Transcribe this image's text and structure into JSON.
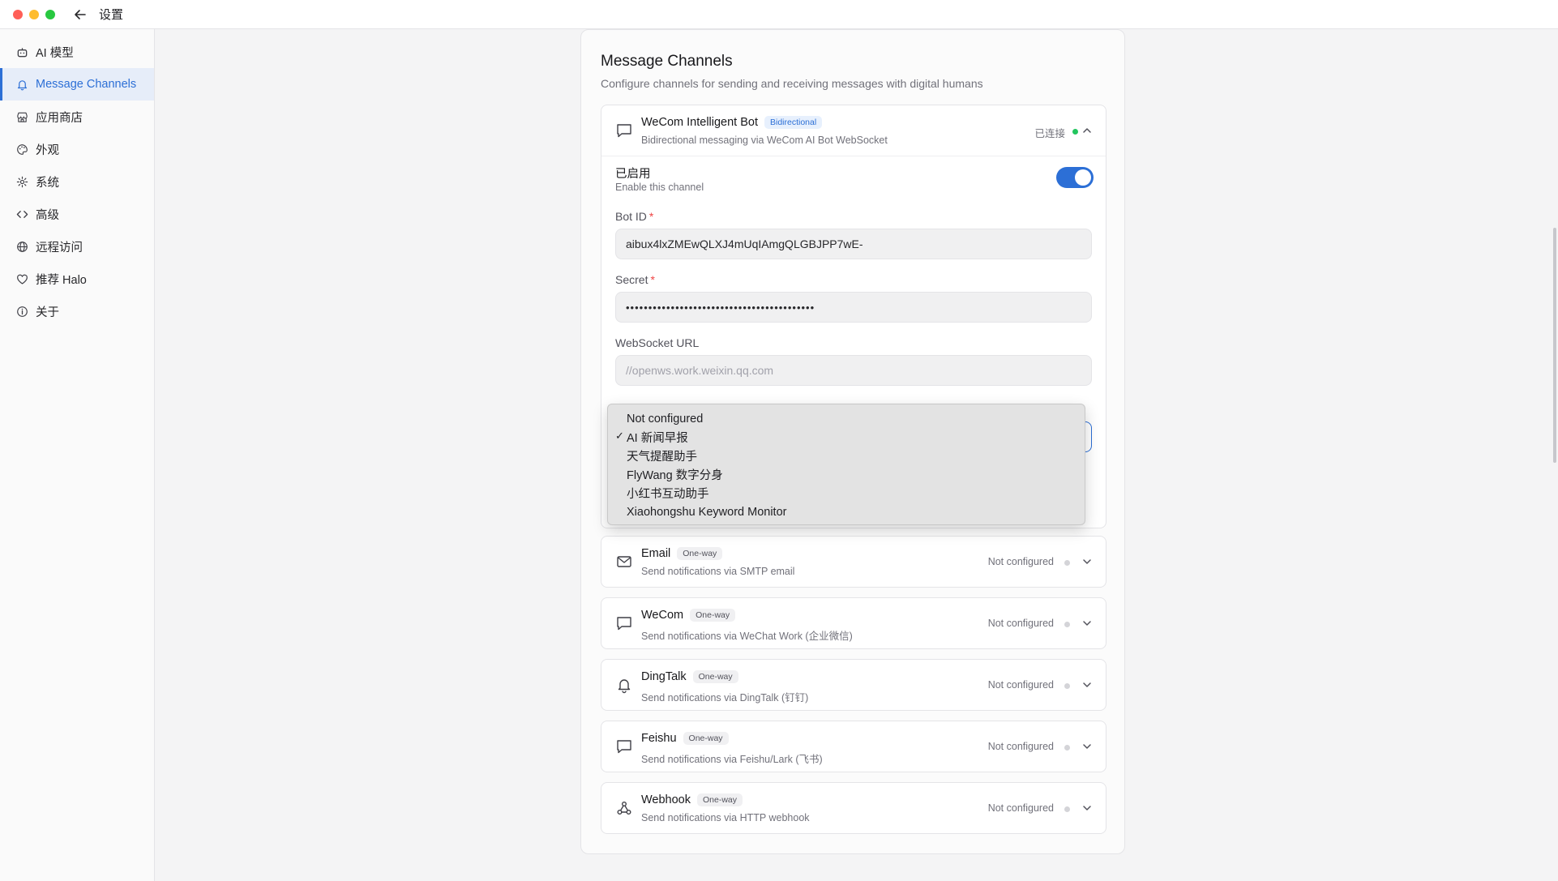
{
  "window": {
    "title": "设置"
  },
  "sidebar": {
    "items": [
      {
        "label": "AI 模型",
        "icon": "robot-icon",
        "active": false
      },
      {
        "label": "Message Channels",
        "icon": "bell-icon",
        "active": true
      },
      {
        "label": "应用商店",
        "icon": "store-icon",
        "active": false
      },
      {
        "label": "外观",
        "icon": "palette-icon",
        "active": false
      },
      {
        "label": "系统",
        "icon": "gear-icon",
        "active": false
      },
      {
        "label": "高级",
        "icon": "code-icon",
        "active": false
      },
      {
        "label": "远程访问",
        "icon": "globe-icon",
        "active": false
      },
      {
        "label": "推荐 Halo",
        "icon": "heart-icon",
        "active": false
      },
      {
        "label": "关于",
        "icon": "info-icon",
        "active": false
      }
    ]
  },
  "panel": {
    "title": "Message Channels",
    "subtitle": "Configure channels for sending and receiving messages with digital humans"
  },
  "wecom_bot": {
    "name": "WeCom Intelligent Bot",
    "badge": "Bidirectional",
    "description": "Bidirectional messaging via WeCom AI Bot WebSocket",
    "status": "已连接",
    "enabled_title": "已启用",
    "enabled_subtitle": "Enable this channel",
    "enabled": true,
    "bot_id_label": "Bot ID",
    "bot_id_value": "aibux4lxZMEwQLXJ4mUqIAmgQLGBJPP7wE-",
    "secret_label": "Secret",
    "secret_value": "••••••••••••••••••••••••••••••••••••••••••",
    "ws_label": "WebSocket URL",
    "ws_placeholder": "//openws.work.weixin.qq.com"
  },
  "dropdown": {
    "options": [
      {
        "label": "Not configured",
        "checked": false
      },
      {
        "label": "AI 新闻早报",
        "checked": true
      },
      {
        "label": "天气提醒助手",
        "checked": false
      },
      {
        "label": "FlyWang 数字分身",
        "checked": false
      },
      {
        "label": "小红书互动助手",
        "checked": false
      },
      {
        "label": "Xiaohongshu Keyword Monitor",
        "checked": false
      }
    ],
    "check_glyph": "✓"
  },
  "channels": [
    {
      "name": "Email",
      "badge": "One-way",
      "description": "Send notifications via SMTP email",
      "status": "Not configured",
      "icon": "mail-icon"
    },
    {
      "name": "WeCom",
      "badge": "One-way",
      "description": "Send notifications via WeChat Work (企业微信)",
      "status": "Not configured",
      "icon": "chat-icon"
    },
    {
      "name": "DingTalk",
      "badge": "One-way",
      "description": "Send notifications via DingTalk (钉钉)",
      "status": "Not configured",
      "icon": "bell-icon"
    },
    {
      "name": "Feishu",
      "badge": "One-way",
      "description": "Send notifications via Feishu/Lark (飞书)",
      "status": "Not configured",
      "icon": "chat-icon"
    },
    {
      "name": "Webhook",
      "badge": "One-way",
      "description": "Send notifications via HTTP webhook",
      "status": "Not configured",
      "icon": "webhook-icon"
    }
  ],
  "colors": {
    "accent": "#2c6fd6",
    "connected": "#22c55e",
    "inactive_dot": "#d4d4d8"
  }
}
